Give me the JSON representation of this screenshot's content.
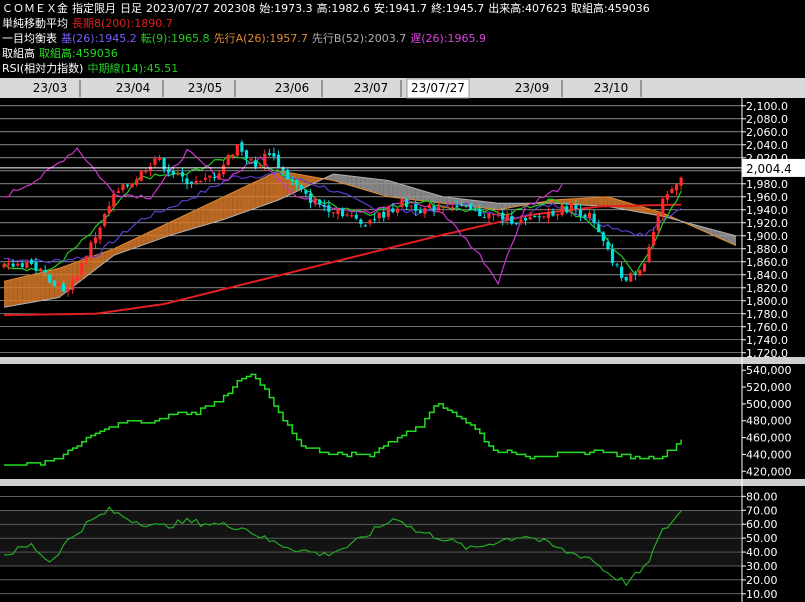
{
  "header": {
    "line1": {
      "symbol": "ＣＯＭＥＸ金",
      "contract": "指定限月",
      "period": "日足",
      "date": "2023/07/27",
      "month": "202308",
      "open_label": "始:",
      "open": "1973.3",
      "high_label": "高:",
      "high": "1982.6",
      "low_label": "安:",
      "low": "1941.7",
      "close_label": "終:",
      "close": "1945.7",
      "volume_label": "出来高:",
      "volume": "407623",
      "oi_label": "取組高:",
      "oi": "459036"
    },
    "line2": {
      "title": "単純移動平均",
      "sma_label": "長期8(200):",
      "sma_value": "1890.7"
    },
    "line3": {
      "title": "一目均衡表",
      "kijun_label": "基(26):",
      "kijun_value": "1945.2",
      "tenkan_label": "転(9):",
      "tenkan_value": "1965.8",
      "spanA_label": "先行A(26):",
      "spanA_value": "1957.7",
      "spanB_label": "先行B(52):",
      "spanB_value": "2003.7",
      "chikou_label": "遅(26):",
      "chikou_value": "1965.9"
    },
    "line4": {
      "title": "取組高",
      "oi_label": "取組高:",
      "oi_value": "459036"
    },
    "line5": {
      "title": "RSI(相対力指数)",
      "rsi_label": "中期線(14):",
      "rsi_value": "45.51"
    }
  },
  "time_axis": {
    "labels": [
      "23/03",
      "23/04",
      "23/05",
      "23/06",
      "23/07",
      "23/07/27",
      "23/09",
      "23/10"
    ],
    "cursor_label": "23/07/27"
  },
  "price_panel": {
    "ticks": [
      "2,100.0",
      "2,080.0",
      "2,060.0",
      "2,040.0",
      "2,020.0",
      "2,000.0",
      "1,980.0",
      "1,960.0",
      "1,940.0",
      "1,920.0",
      "1,900.0",
      "1,880.0",
      "1,860.0",
      "1,840.0",
      "1,820.0",
      "1,800.0",
      "1,780.0",
      "1,760.0",
      "1,740.0",
      "1,720.0"
    ],
    "current_price_label": "2,004.4",
    "current_price": 2004.4,
    "ylim": [
      1715,
      2112
    ]
  },
  "oi_panel": {
    "ticks": [
      "540,000",
      "520,000",
      "500,000",
      "480,000",
      "460,000",
      "440,000",
      "420,000"
    ],
    "ylim": [
      412000,
      545000
    ]
  },
  "rsi_panel": {
    "ticks": [
      "80.00",
      "70.00",
      "60.00",
      "50.00",
      "40.00",
      "30.00",
      "20.00",
      "10.00"
    ],
    "ylim": [
      7,
      86
    ]
  },
  "colors": {
    "background": "#000000",
    "grid": "#ffffff",
    "candle_up": "#ff2a2a",
    "candle_down": "#00e0e0",
    "sma": "#e02020",
    "kijun": "#5a3ccc",
    "tenkan": "#22cc22",
    "chikou": "#cc33cc",
    "cloud_bull": "#d97a2a",
    "cloud_bear": "#9a9a9a",
    "open_interest": "#22dd22",
    "rsi": "#22aa22",
    "text": "#ffffff",
    "axis_bar": "#d8d8d8",
    "cursor_bg": "#e6e6e6"
  },
  "chart_data": [
    {
      "type": "line",
      "title": "ＣＯＭＥＸ金 指定限月 日足",
      "xlabel": "",
      "ylabel": "",
      "ylim": [
        1715,
        2112
      ],
      "candle_anchors": [
        {
          "x": 0,
          "y": 1850
        },
        {
          "x": 5,
          "y": 1860
        },
        {
          "x": 10,
          "y": 1835
        },
        {
          "x": 14,
          "y": 1815
        },
        {
          "x": 20,
          "y": 1900
        },
        {
          "x": 24,
          "y": 1960
        },
        {
          "x": 29,
          "y": 1990
        },
        {
          "x": 33,
          "y": 2020
        },
        {
          "x": 38,
          "y": 1990
        },
        {
          "x": 43,
          "y": 1980
        },
        {
          "x": 47,
          "y": 2000
        },
        {
          "x": 51,
          "y": 2040
        },
        {
          "x": 55,
          "y": 2005
        },
        {
          "x": 58,
          "y": 2030
        },
        {
          "x": 62,
          "y": 1990
        },
        {
          "x": 66,
          "y": 1960
        },
        {
          "x": 70,
          "y": 1945
        },
        {
          "x": 73,
          "y": 1940
        },
        {
          "x": 78,
          "y": 1920
        },
        {
          "x": 82,
          "y": 1930
        },
        {
          "x": 87,
          "y": 1950
        },
        {
          "x": 92,
          "y": 1940
        },
        {
          "x": 97,
          "y": 1950
        },
        {
          "x": 103,
          "y": 1935
        },
        {
          "x": 108,
          "y": 1930
        },
        {
          "x": 114,
          "y": 1920
        },
        {
          "x": 119,
          "y": 1935
        },
        {
          "x": 124,
          "y": 1945
        },
        {
          "x": 128,
          "y": 1930
        },
        {
          "x": 133,
          "y": 1860
        },
        {
          "x": 136,
          "y": 1830
        },
        {
          "x": 140,
          "y": 1860
        },
        {
          "x": 144,
          "y": 1950
        },
        {
          "x": 148,
          "y": 1995
        }
      ],
      "series": [
        {
          "name": "長期8(200)",
          "values": [
            {
              "x": 0,
              "y": 1778
            },
            {
              "x": 20,
              "y": 1780
            },
            {
              "x": 35,
              "y": 1795
            },
            {
              "x": 55,
              "y": 1830
            },
            {
              "x": 75,
              "y": 1865
            },
            {
              "x": 95,
              "y": 1900
            },
            {
              "x": 115,
              "y": 1932
            },
            {
              "x": 130,
              "y": 1945
            },
            {
              "x": 148,
              "y": 1948
            }
          ]
        },
        {
          "name": "基(26)",
          "values": [
            {
              "x": 0,
              "y": 1865
            },
            {
              "x": 10,
              "y": 1860
            },
            {
              "x": 20,
              "y": 1870
            },
            {
              "x": 30,
              "y": 1925
            },
            {
              "x": 40,
              "y": 1955
            },
            {
              "x": 50,
              "y": 1990
            },
            {
              "x": 60,
              "y": 1995
            },
            {
              "x": 70,
              "y": 1975
            },
            {
              "x": 80,
              "y": 1945
            },
            {
              "x": 90,
              "y": 1935
            },
            {
              "x": 100,
              "y": 1950
            },
            {
              "x": 110,
              "y": 1925
            },
            {
              "x": 120,
              "y": 1950
            },
            {
              "x": 130,
              "y": 1920
            },
            {
              "x": 140,
              "y": 1900
            },
            {
              "x": 148,
              "y": 1945
            }
          ]
        },
        {
          "name": "転(9)",
          "values": [
            {
              "x": 0,
              "y": 1855
            },
            {
              "x": 10,
              "y": 1845
            },
            {
              "x": 20,
              "y": 1910
            },
            {
              "x": 30,
              "y": 1990
            },
            {
              "x": 40,
              "y": 1995
            },
            {
              "x": 50,
              "y": 2025
            },
            {
              "x": 60,
              "y": 2000
            },
            {
              "x": 70,
              "y": 1950
            },
            {
              "x": 80,
              "y": 1935
            },
            {
              "x": 90,
              "y": 1955
            },
            {
              "x": 100,
              "y": 1940
            },
            {
              "x": 110,
              "y": 1935
            },
            {
              "x": 120,
              "y": 1955
            },
            {
              "x": 130,
              "y": 1910
            },
            {
              "x": 138,
              "y": 1840
            },
            {
              "x": 148,
              "y": 1966
            }
          ]
        },
        {
          "name": "遅(26)",
          "values": [
            {
              "x": 0,
              "y": 1960
            },
            {
              "x": 8,
              "y": 1990
            },
            {
              "x": 16,
              "y": 2035
            },
            {
              "x": 24,
              "y": 1965
            },
            {
              "x": 32,
              "y": 1960
            },
            {
              "x": 40,
              "y": 2030
            },
            {
              "x": 48,
              "y": 1985
            },
            {
              "x": 56,
              "y": 2020
            },
            {
              "x": 64,
              "y": 1960
            },
            {
              "x": 72,
              "y": 1945
            },
            {
              "x": 80,
              "y": 1935
            },
            {
              "x": 88,
              "y": 1955
            },
            {
              "x": 96,
              "y": 1935
            },
            {
              "x": 104,
              "y": 1870
            },
            {
              "x": 108,
              "y": 1830
            },
            {
              "x": 114,
              "y": 1945
            },
            {
              "x": 122,
              "y": 1975
            }
          ]
        }
      ],
      "cloud": {
        "span_a": [
          {
            "x": 0,
            "y": 1830
          },
          {
            "x": 12,
            "y": 1850
          },
          {
            "x": 24,
            "y": 1880
          },
          {
            "x": 36,
            "y": 1920
          },
          {
            "x": 48,
            "y": 1960
          },
          {
            "x": 60,
            "y": 2000
          },
          {
            "x": 72,
            "y": 1985
          },
          {
            "x": 84,
            "y": 1960
          },
          {
            "x": 96,
            "y": 1950
          },
          {
            "x": 108,
            "y": 1940
          },
          {
            "x": 120,
            "y": 1955
          },
          {
            "x": 132,
            "y": 1960
          },
          {
            "x": 144,
            "y": 1935
          },
          {
            "x": 160,
            "y": 1885
          }
        ],
        "span_b": [
          {
            "x": 0,
            "y": 1790
          },
          {
            "x": 12,
            "y": 1805
          },
          {
            "x": 24,
            "y": 1870
          },
          {
            "x": 36,
            "y": 1900
          },
          {
            "x": 48,
            "y": 1925
          },
          {
            "x": 60,
            "y": 1955
          },
          {
            "x": 72,
            "y": 1995
          },
          {
            "x": 84,
            "y": 1985
          },
          {
            "x": 96,
            "y": 1960
          },
          {
            "x": 108,
            "y": 1950
          },
          {
            "x": 120,
            "y": 1950
          },
          {
            "x": 132,
            "y": 1945
          },
          {
            "x": 144,
            "y": 1930
          },
          {
            "x": 160,
            "y": 1900
          }
        ]
      }
    },
    {
      "type": "line",
      "title": "取組高",
      "ylim": [
        412000,
        545000
      ],
      "series": [
        {
          "name": "取組高",
          "values": [
            {
              "x": 0,
              "y": 428000
            },
            {
              "x": 8,
              "y": 430000
            },
            {
              "x": 13,
              "y": 438000
            },
            {
              "x": 17,
              "y": 455000
            },
            {
              "x": 22,
              "y": 470000
            },
            {
              "x": 27,
              "y": 480000
            },
            {
              "x": 32,
              "y": 478000
            },
            {
              "x": 37,
              "y": 488000
            },
            {
              "x": 42,
              "y": 490000
            },
            {
              "x": 47,
              "y": 505000
            },
            {
              "x": 51,
              "y": 525000
            },
            {
              "x": 54,
              "y": 535000
            },
            {
              "x": 57,
              "y": 515000
            },
            {
              "x": 61,
              "y": 480000
            },
            {
              "x": 65,
              "y": 450000
            },
            {
              "x": 72,
              "y": 440000
            },
            {
              "x": 80,
              "y": 440000
            },
            {
              "x": 86,
              "y": 460000
            },
            {
              "x": 91,
              "y": 475000
            },
            {
              "x": 94,
              "y": 500000
            },
            {
              "x": 98,
              "y": 490000
            },
            {
              "x": 103,
              "y": 470000
            },
            {
              "x": 107,
              "y": 445000
            },
            {
              "x": 115,
              "y": 438000
            },
            {
              "x": 122,
              "y": 440000
            },
            {
              "x": 130,
              "y": 445000
            },
            {
              "x": 138,
              "y": 435000
            },
            {
              "x": 144,
              "y": 438000
            },
            {
              "x": 148,
              "y": 458000
            }
          ]
        }
      ]
    },
    {
      "type": "line",
      "title": "RSI(相対力指数)",
      "ylim": [
        7,
        86
      ],
      "series": [
        {
          "name": "中期線(14)",
          "values": [
            {
              "x": 0,
              "y": 38
            },
            {
              "x": 6,
              "y": 45
            },
            {
              "x": 10,
              "y": 33
            },
            {
              "x": 14,
              "y": 48
            },
            {
              "x": 18,
              "y": 60
            },
            {
              "x": 23,
              "y": 70
            },
            {
              "x": 28,
              "y": 63
            },
            {
              "x": 34,
              "y": 58
            },
            {
              "x": 40,
              "y": 62
            },
            {
              "x": 46,
              "y": 60
            },
            {
              "x": 52,
              "y": 58
            },
            {
              "x": 58,
              "y": 48
            },
            {
              "x": 64,
              "y": 42
            },
            {
              "x": 70,
              "y": 38
            },
            {
              "x": 76,
              "y": 45
            },
            {
              "x": 82,
              "y": 58
            },
            {
              "x": 86,
              "y": 65
            },
            {
              "x": 90,
              "y": 55
            },
            {
              "x": 96,
              "y": 50
            },
            {
              "x": 102,
              "y": 42
            },
            {
              "x": 108,
              "y": 48
            },
            {
              "x": 114,
              "y": 52
            },
            {
              "x": 118,
              "y": 47
            },
            {
              "x": 123,
              "y": 40
            },
            {
              "x": 128,
              "y": 36
            },
            {
              "x": 132,
              "y": 25
            },
            {
              "x": 136,
              "y": 18
            },
            {
              "x": 140,
              "y": 28
            },
            {
              "x": 144,
              "y": 55
            },
            {
              "x": 148,
              "y": 69
            }
          ]
        }
      ]
    }
  ]
}
